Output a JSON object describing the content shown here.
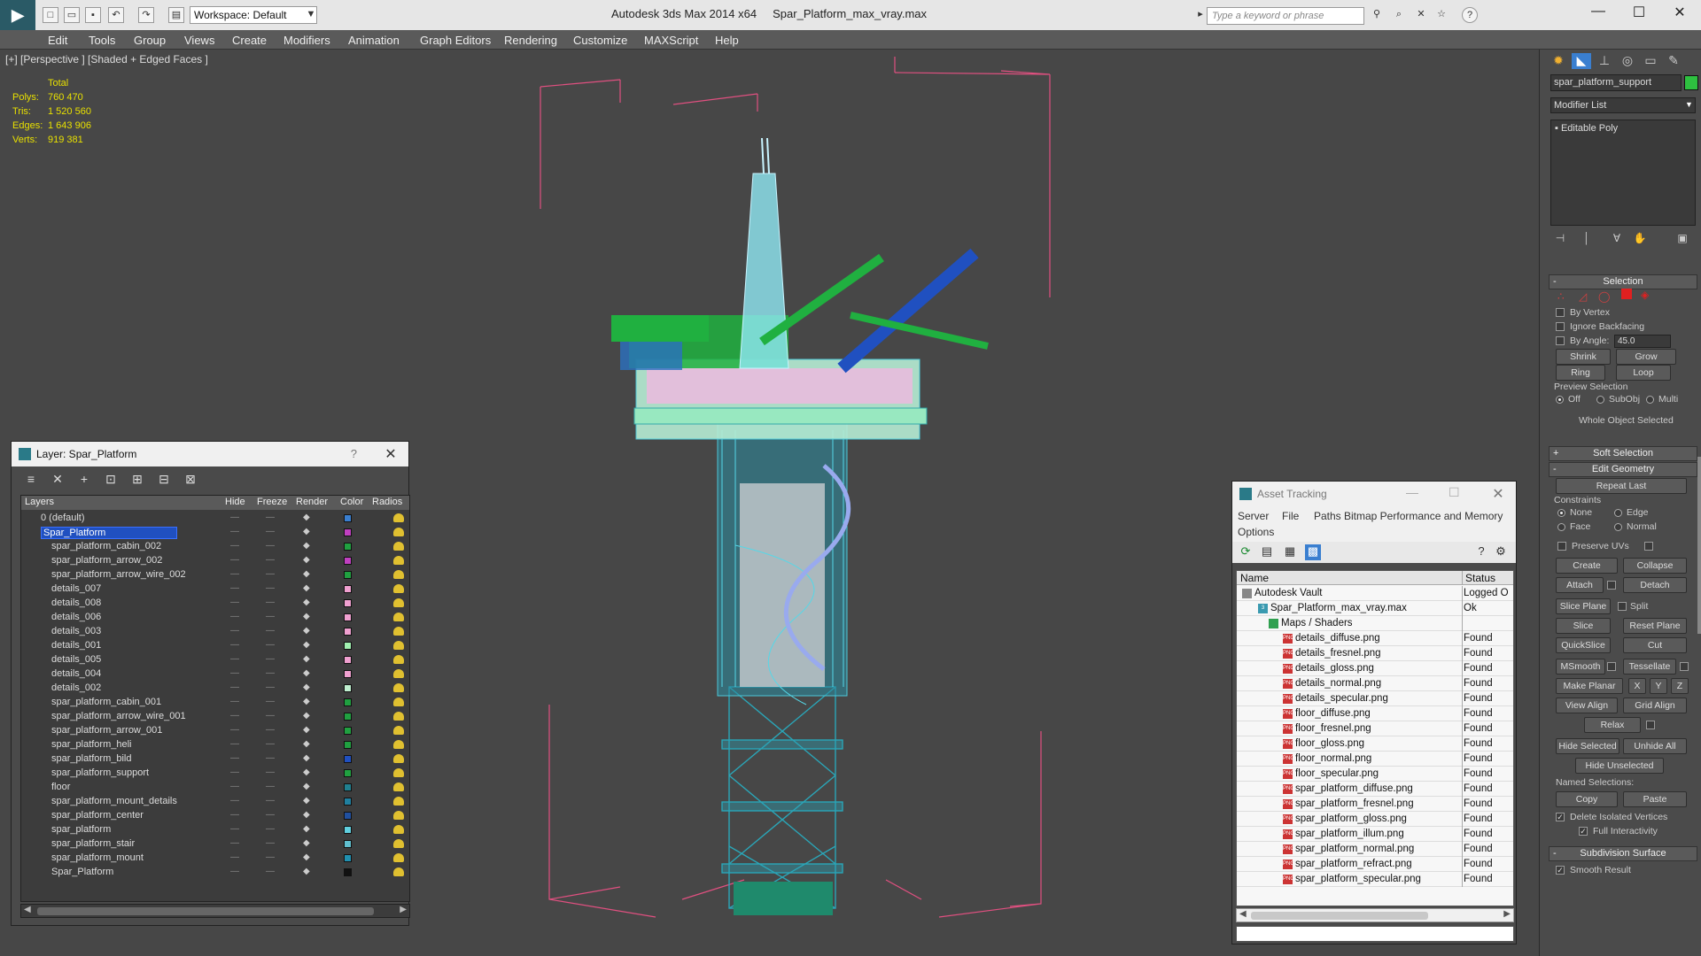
{
  "app": {
    "title": "Autodesk 3ds Max 2014 x64",
    "file_name": "Spar_Platform_max_vray.max",
    "workspace_label": "Workspace: Default",
    "search_placeholder": "Type a keyword or phrase"
  },
  "menu": [
    "Edit",
    "Tools",
    "Group",
    "Views",
    "Create",
    "Modifiers",
    "Animation",
    "Graph Editors",
    "Rendering",
    "Customize",
    "MAXScript",
    "Help"
  ],
  "viewport": {
    "label": "[+] [Perspective ] [Shaded + Edged Faces ]",
    "stats": {
      "header": "Total",
      "polys_label": "Polys:",
      "polys": "760 470",
      "tris_label": "Tris:",
      "tris": "1 520 560",
      "edges_label": "Edges:",
      "edges": "1 643 906",
      "verts_label": "Verts:",
      "verts": "919 381"
    }
  },
  "layer_panel": {
    "title": "Layer: Spar_Platform",
    "help": "?",
    "columns": [
      "Layers",
      "Hide",
      "Freeze",
      "Render",
      "Color",
      "Radios"
    ],
    "layers": [
      {
        "name": "0 (default)",
        "color": "#3a7fd0"
      },
      {
        "name": "Spar_Platform",
        "color": "#c040c0"
      },
      {
        "name": "spar_platform_cabin_002",
        "color": "#20a040"
      },
      {
        "name": "spar_platform_arrow_002",
        "color": "#c040c0"
      },
      {
        "name": "spar_platform_arrow_wire_002",
        "color": "#20a040"
      },
      {
        "name": "details_007",
        "color": "#f0a0d0"
      },
      {
        "name": "details_008",
        "color": "#f0a0d0"
      },
      {
        "name": "details_006",
        "color": "#f0a0d0"
      },
      {
        "name": "details_003",
        "color": "#f0a0d0"
      },
      {
        "name": "details_001",
        "color": "#a0f0b0"
      },
      {
        "name": "details_005",
        "color": "#f0a0d0"
      },
      {
        "name": "details_004",
        "color": "#f0a0d0"
      },
      {
        "name": "details_002",
        "color": "#c0f0d0"
      },
      {
        "name": "spar_platform_cabin_001",
        "color": "#20a040"
      },
      {
        "name": "spar_platform_arrow_wire_001",
        "color": "#20a040"
      },
      {
        "name": "spar_platform_arrow_001",
        "color": "#20a040"
      },
      {
        "name": "spar_platform_heli",
        "color": "#20a040"
      },
      {
        "name": "spar_platform_bild",
        "color": "#2050c0"
      },
      {
        "name": "spar_platform_support",
        "color": "#20a040"
      },
      {
        "name": "floor",
        "color": "#208090"
      },
      {
        "name": "spar_platform_mount_details",
        "color": "#2080a0"
      },
      {
        "name": "spar_platform_center",
        "color": "#2050a0"
      },
      {
        "name": "spar_platform",
        "color": "#60d0e0"
      },
      {
        "name": "spar_platform_stair",
        "color": "#60c0d0"
      },
      {
        "name": "spar_platform_mount",
        "color": "#2090b0"
      },
      {
        "name": "Spar_Platform",
        "color": "#111111"
      }
    ]
  },
  "asset_panel": {
    "title": "Asset Tracking",
    "menu": [
      "Server",
      "File",
      "Paths",
      "Bitmap Performance and Memory",
      "Options"
    ],
    "columns": [
      "Name",
      "Status"
    ],
    "rows": [
      {
        "name": "Autodesk Vault",
        "status": "Logged O",
        "level": 0
      },
      {
        "name": "Spar_Platform_max_vray.max",
        "status": "Ok",
        "level": 1
      },
      {
        "name": "Maps / Shaders",
        "status": "",
        "level": 2
      },
      {
        "name": "details_diffuse.png",
        "status": "Found",
        "level": 3
      },
      {
        "name": "details_fresnel.png",
        "status": "Found",
        "level": 3
      },
      {
        "name": "details_gloss.png",
        "status": "Found",
        "level": 3
      },
      {
        "name": "details_normal.png",
        "status": "Found",
        "level": 3
      },
      {
        "name": "details_specular.png",
        "status": "Found",
        "level": 3
      },
      {
        "name": "floor_diffuse.png",
        "status": "Found",
        "level": 3
      },
      {
        "name": "floor_fresnel.png",
        "status": "Found",
        "level": 3
      },
      {
        "name": "floor_gloss.png",
        "status": "Found",
        "level": 3
      },
      {
        "name": "floor_normal.png",
        "status": "Found",
        "level": 3
      },
      {
        "name": "floor_specular.png",
        "status": "Found",
        "level": 3
      },
      {
        "name": "spar_platform_diffuse.png",
        "status": "Found",
        "level": 3
      },
      {
        "name": "spar_platform_fresnel.png",
        "status": "Found",
        "level": 3
      },
      {
        "name": "spar_platform_gloss.png",
        "status": "Found",
        "level": 3
      },
      {
        "name": "spar_platform_illum.png",
        "status": "Found",
        "level": 3
      },
      {
        "name": "spar_platform_normal.png",
        "status": "Found",
        "level": 3
      },
      {
        "name": "spar_platform_refract.png",
        "status": "Found",
        "level": 3
      },
      {
        "name": "spar_platform_specular.png",
        "status": "Found",
        "level": 3
      }
    ]
  },
  "command_panel": {
    "object_name": "spar_platform_support",
    "object_color": "#2ec040",
    "modifier_list": "Modifier List",
    "stack_item": "Editable Poly",
    "selection": {
      "header": "Selection",
      "by_vertex": "By Vertex",
      "ignore_backfacing": "Ignore Backfacing",
      "by_angle": "By Angle:",
      "angle_value": "45.0",
      "shrink": "Shrink",
      "grow": "Grow",
      "ring": "Ring",
      "loop": "Loop",
      "preview_selection": "Preview Selection",
      "off": "Off",
      "subobj": "SubObj",
      "multi": "Multi",
      "whole_object": "Whole Object Selected"
    },
    "soft_selection": "Soft Selection",
    "edit_geometry": {
      "header": "Edit Geometry",
      "repeat_last": "Repeat Last",
      "constraints": "Constraints",
      "none": "None",
      "edge": "Edge",
      "face": "Face",
      "normal": "Normal",
      "preserve_uvs": "Preserve UVs",
      "create": "Create",
      "collapse": "Collapse",
      "attach": "Attach",
      "detach": "Detach",
      "slice_plane": "Slice Plane",
      "split": "Split",
      "slice": "Slice",
      "reset_plane": "Reset Plane",
      "quickslice": "QuickSlice",
      "cut": "Cut",
      "msmooth": "MSmooth",
      "tessellate": "Tessellate",
      "make_planar": "Make Planar",
      "x": "X",
      "y": "Y",
      "z": "Z",
      "view_align": "View Align",
      "grid_align": "Grid Align",
      "relax": "Relax",
      "hide_selected": "Hide Selected",
      "unhide_all": "Unhide All",
      "hide_unselected": "Hide Unselected",
      "named_selections": "Named Selections:",
      "copy": "Copy",
      "paste": "Paste",
      "delete_isolated": "Delete Isolated Vertices",
      "full_interactivity": "Full Interactivity"
    },
    "subdivision": {
      "header": "Subdivision Surface",
      "smooth_result": "Smooth Result"
    }
  },
  "colors": {
    "accent_selected": "#2050c0",
    "stats_text": "#e8e000",
    "bbox": "#e05080"
  }
}
